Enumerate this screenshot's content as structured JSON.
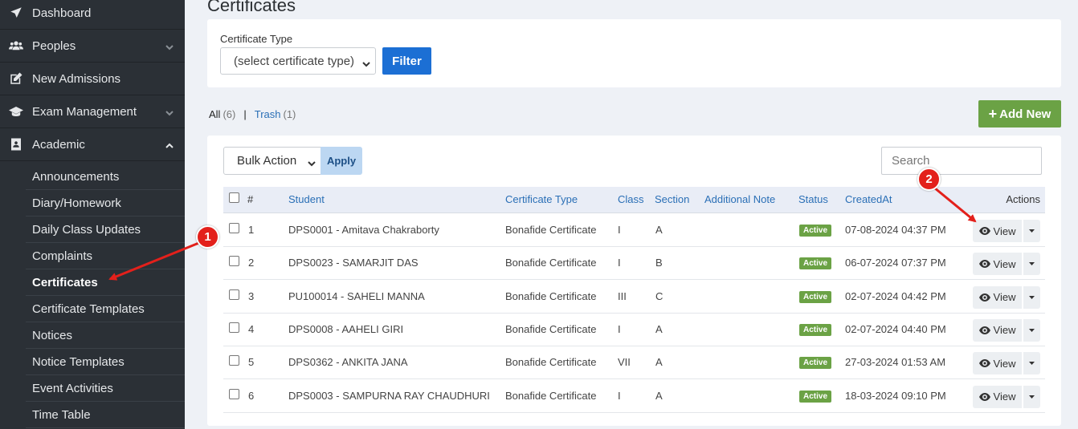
{
  "sidebar": {
    "items": [
      {
        "label": "Dashboard",
        "icon": "rocket-icon"
      },
      {
        "label": "Peoples",
        "icon": "users-icon"
      },
      {
        "label": "New Admissions",
        "icon": "edit-icon"
      },
      {
        "label": "Exam Management",
        "icon": "graduation-cap-icon"
      },
      {
        "label": "Academic",
        "icon": "address-book-icon"
      }
    ],
    "sub_items": [
      "Announcements",
      "Diary/Homework",
      "Daily Class Updates",
      "Complaints",
      "Certificates",
      "Certificate Templates",
      "Notices",
      "Notice Templates",
      "Event Activities",
      "Time Table"
    ]
  },
  "page": {
    "title": "Certificates"
  },
  "filter": {
    "label": "Certificate Type",
    "select_value": "(select certificate type)",
    "button": "Filter"
  },
  "tabs": {
    "all_label": "All",
    "all_count": "(6)",
    "separator": "|",
    "trash_label": "Trash",
    "trash_count": "(1)"
  },
  "add_new_label": "Add New",
  "toolbar": {
    "bulk_value": "Bulk Action",
    "apply_label": "Apply",
    "search_placeholder": "Search"
  },
  "table": {
    "headers": {
      "num": "#",
      "student": "Student",
      "certificate_type": "Certificate Type",
      "class": "Class",
      "section": "Section",
      "note": "Additional Note",
      "status": "Status",
      "created": "CreatedAt",
      "actions": "Actions"
    },
    "rows": [
      {
        "num": "1",
        "student": "DPS0001 - Amitava Chakraborty",
        "type": "Bonafide Certificate",
        "class": "I",
        "section": "A",
        "note": "",
        "status": "Active",
        "created": "07-08-2024 04:37 PM",
        "action": "View"
      },
      {
        "num": "2",
        "student": "DPS0023 - SAMARJIT DAS",
        "type": "Bonafide Certificate",
        "class": "I",
        "section": "B",
        "note": "",
        "status": "Active",
        "created": "06-07-2024 07:37 PM",
        "action": "View"
      },
      {
        "num": "3",
        "student": "PU100014 - SAHELI MANNA",
        "type": "Bonafide Certificate",
        "class": "III",
        "section": "C",
        "note": "",
        "status": "Active",
        "created": "02-07-2024 04:42 PM",
        "action": "View"
      },
      {
        "num": "4",
        "student": "DPS0008 - AAHELI GIRI",
        "type": "Bonafide Certificate",
        "class": "I",
        "section": "A",
        "note": "",
        "status": "Active",
        "created": "02-07-2024 04:40 PM",
        "action": "View"
      },
      {
        "num": "5",
        "student": "DPS0362 - ANKITA JANA",
        "type": "Bonafide Certificate",
        "class": "VII",
        "section": "A",
        "note": "",
        "status": "Active",
        "created": "27-03-2024 01:53 AM",
        "action": "View"
      },
      {
        "num": "6",
        "student": "DPS0003 - SAMPURNA RAY CHAUDHURI",
        "type": "Bonafide Certificate",
        "class": "I",
        "section": "A",
        "note": "",
        "status": "Active",
        "created": "18-03-2024 09:10 PM",
        "action": "View"
      }
    ]
  },
  "annotations": {
    "marker_1": "1",
    "marker_2": "2"
  },
  "colors": {
    "sidebar_bg": "#2b3036",
    "primary": "#1c6fd4",
    "success": "#6ba245",
    "link": "#2a6fb6",
    "annotation": "#e3201b"
  }
}
